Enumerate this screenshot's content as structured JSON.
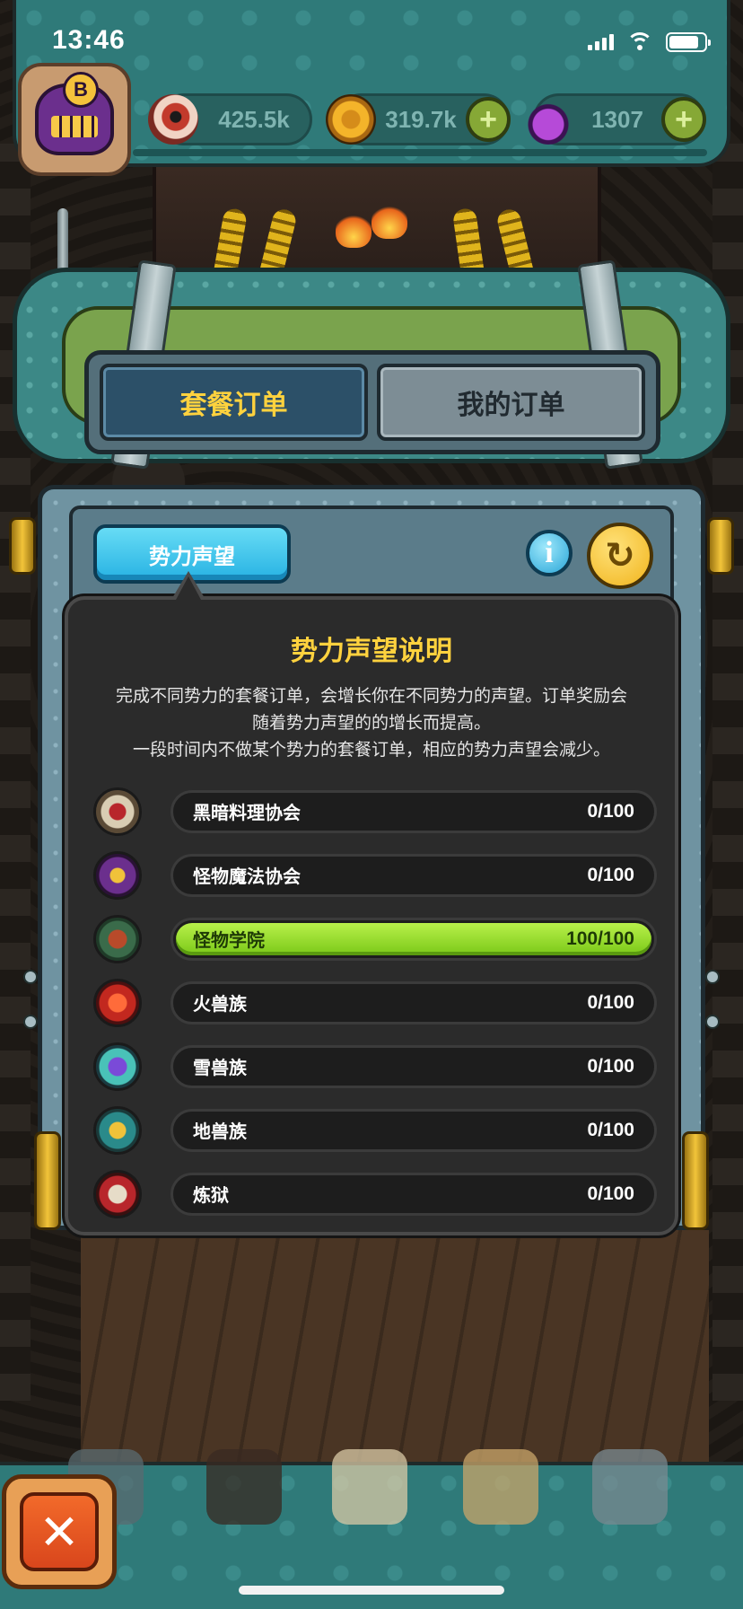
{
  "status_bar": {
    "time": "13:46"
  },
  "resources": {
    "eye": {
      "value": "425.5k",
      "icon": "eyeball-icon"
    },
    "coin": {
      "value": "319.7k",
      "icon": "coin-icon"
    },
    "potion": {
      "value": "1307",
      "icon": "potion-icon"
    },
    "plus": "+"
  },
  "player": {
    "rank_badge": "B"
  },
  "tabs": [
    {
      "label": "套餐订单",
      "active": true
    },
    {
      "label": "我的订单",
      "active": false
    }
  ],
  "faction_button": "势力声望",
  "info_glyph": "i",
  "refresh_glyph": "↻",
  "tooltip": {
    "title": "势力声望说明",
    "lines": [
      "完成不同势力的套餐订单，会增长你在不同势力的声望。订单奖励会",
      "随着势力声望的的增长而提高。",
      "一段时间内不做某个势力的套餐订单，相应的势力声望会减少。"
    ]
  },
  "factions": [
    {
      "name": "黑暗料理协会",
      "progress": "0/100",
      "fraction": 0
    },
    {
      "name": "怪物魔法协会",
      "progress": "0/100",
      "fraction": 0
    },
    {
      "name": "怪物学院",
      "progress": "100/100",
      "fraction": 1
    },
    {
      "name": "火兽族",
      "progress": "0/100",
      "fraction": 0
    },
    {
      "name": "雪兽族",
      "progress": "0/100",
      "fraction": 0
    },
    {
      "name": "地兽族",
      "progress": "0/100",
      "fraction": 0
    },
    {
      "name": "炼狱",
      "progress": "0/100",
      "fraction": 0
    }
  ],
  "close_glyph": "✕",
  "colors": {
    "accent_yellow": "#ffd23e",
    "progress_green": "#8ad21e",
    "tab_active": "#2c5068"
  }
}
